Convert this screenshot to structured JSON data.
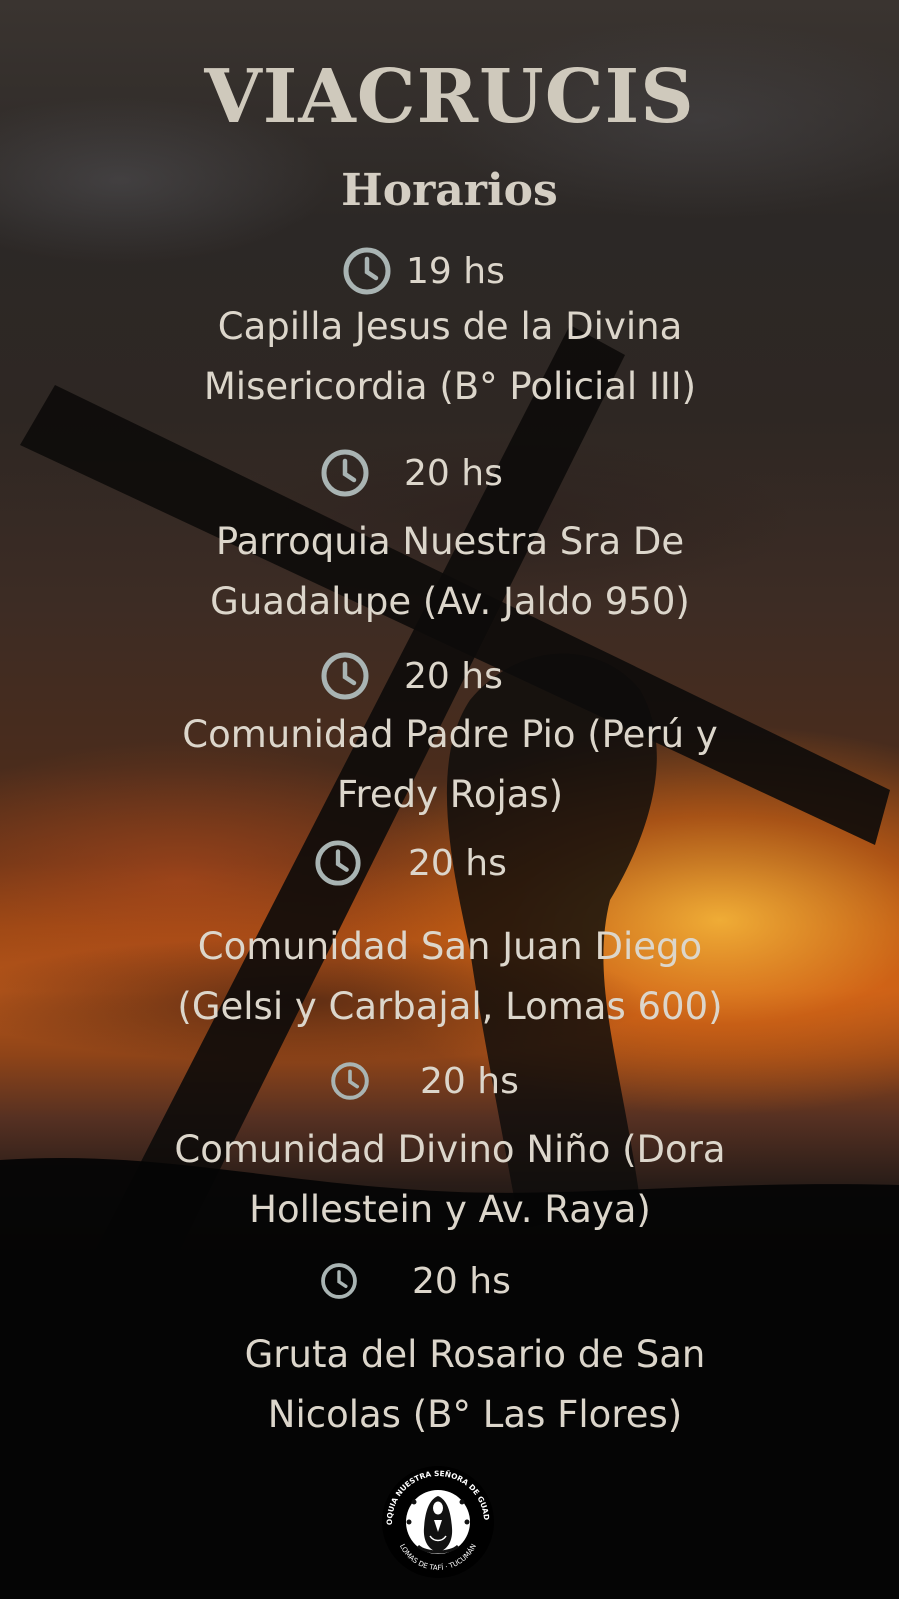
{
  "title": "VIACRUCIS",
  "subtitle": "Horarios",
  "schedule": [
    {
      "time": "19 hs",
      "place_line1": "Capilla Jesus de la Divina",
      "place_line2": "Misericordia (B° Policial III)"
    },
    {
      "time": "20 hs",
      "place_line1": "Parroquia Nuestra Sra De",
      "place_line2": "Guadalupe (Av. Jaldo 950)"
    },
    {
      "time": "20 hs",
      "place_line1": "Comunidad Padre Pio (Perú y",
      "place_line2": "Fredy Rojas)"
    },
    {
      "time": "20 hs",
      "place_line1": "Comunidad San Juan Diego",
      "place_line2": "(Gelsi y Carbajal, Lomas 600)"
    },
    {
      "time": "20 hs",
      "place_line1": "Comunidad Divino Niño (Dora",
      "place_line2": "Hollestein y Av. Raya)"
    },
    {
      "time": "20 hs",
      "place_line1": "Gruta del Rosario de San",
      "place_line2": "Nicolas (B° Las Flores)"
    }
  ],
  "logo": {
    "text": "PARROQUIA NUESTRA SEÑORA DE GUADALUPE · LOMAS DE TAFÍ · TUCUMÁN"
  },
  "icons": {
    "time": "clock-icon"
  },
  "colors": {
    "text": "#dcd6cb",
    "icon": "#a9b4b3",
    "title": "#cfc9bc"
  }
}
